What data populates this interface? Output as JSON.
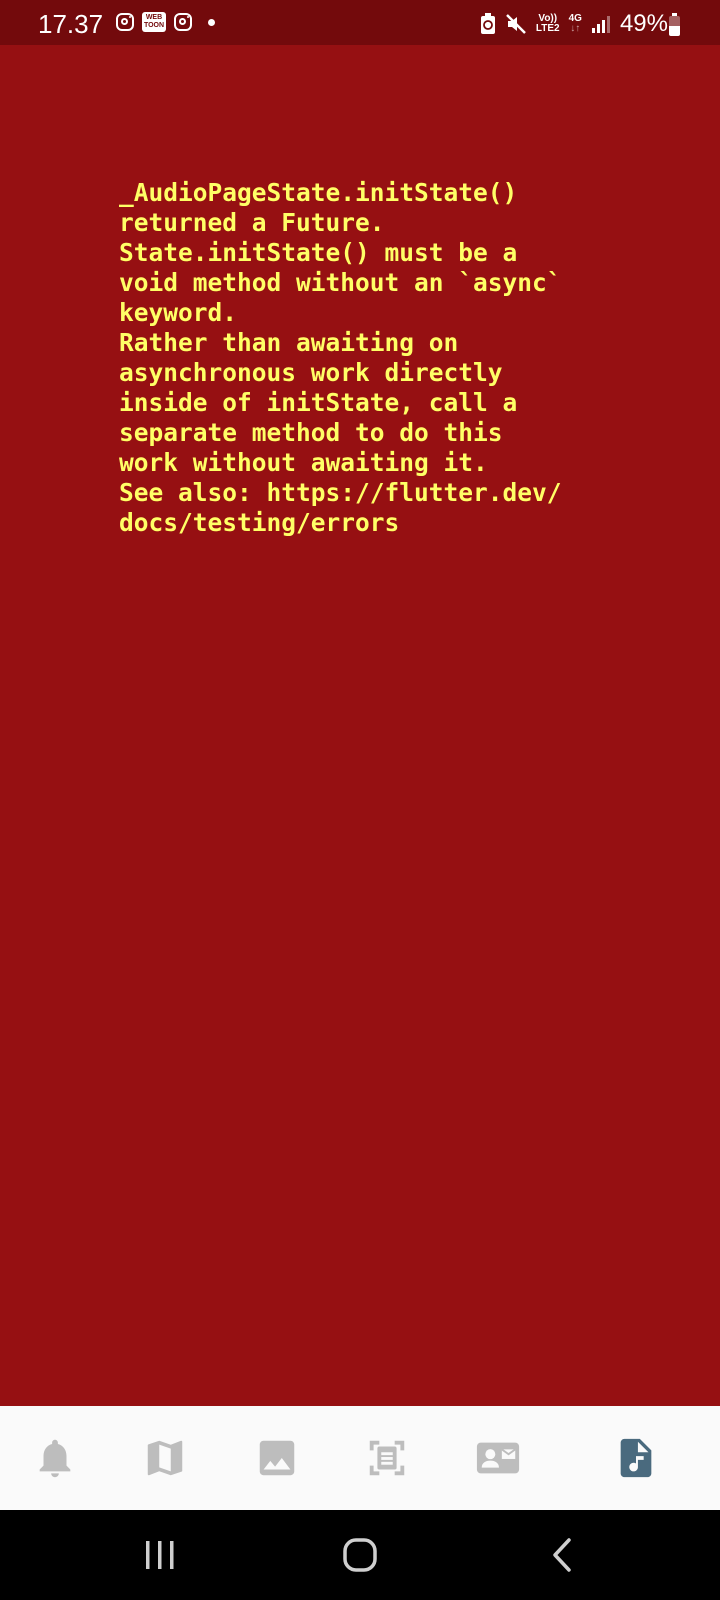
{
  "status_bar": {
    "time": "17.37",
    "webtoon_label_top": "WEB",
    "webtoon_label_bottom": "TOON",
    "volte_label_top": "Vo))",
    "volte_label_bottom": "LTE2",
    "network_label_top": "4G",
    "network_label_bottom": "↓↑",
    "battery_percent": "49%",
    "battery_level": 0.49
  },
  "error_message": "_AudioPageState.initState()\nreturned a Future.\nState.initState() must be a\nvoid method without an `async`\nkeyword.\nRather than awaiting on\nasynchronous work directly\ninside of initState, call a\nseparate method to do this\nwork without awaiting it.\nSee also: https://flutter.dev/\ndocs/testing/errors",
  "bottom_nav": {
    "items": [
      {
        "icon": "bell-icon",
        "active": false
      },
      {
        "icon": "map-icon",
        "active": false
      },
      {
        "icon": "image-icon",
        "active": false
      },
      {
        "icon": "document-scan-icon",
        "active": false
      },
      {
        "icon": "contact-card-icon",
        "active": false
      },
      {
        "icon": "audio-file-icon",
        "active": true
      }
    ]
  },
  "colors": {
    "background": "#961012",
    "status_bar": "#730a0c",
    "error_text": "#ffff66",
    "nav_inactive": "#bdbdbd",
    "nav_active": "#4a6a7e"
  }
}
